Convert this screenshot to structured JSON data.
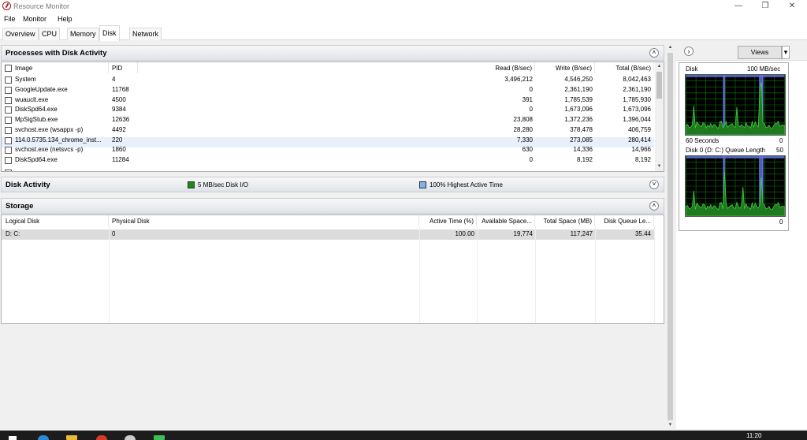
{
  "window": {
    "title": "Resource Monitor",
    "minimize_glyph": "—",
    "maximize_glyph": "❐",
    "close_glyph": "✕"
  },
  "menu": [
    "File",
    "Monitor",
    "Help"
  ],
  "tabs": [
    "Overview",
    "CPU",
    "Memory",
    "Disk",
    "Network"
  ],
  "active_tab": "Disk",
  "processes": {
    "title": "Processes with Disk Activity",
    "collapse_glyph": "˄",
    "columns": [
      "Image",
      "PID",
      "Read (B/sec)",
      "Write (B/sec)",
      "Total (B/sec)"
    ],
    "rows": [
      {
        "image": "System",
        "pid": "4",
        "read": "3,496,212",
        "write": "4,546,250",
        "total": "8,042,463"
      },
      {
        "image": "GoogleUpdate.exe",
        "pid": "11768",
        "read": "0",
        "write": "2,361,190",
        "total": "2,361,190"
      },
      {
        "image": "wuauclt.exe",
        "pid": "4500",
        "read": "391",
        "write": "1,785,539",
        "total": "1,785,930"
      },
      {
        "image": "DiskSpd64.exe",
        "pid": "9384",
        "read": "0",
        "write": "1,673,096",
        "total": "1,673,096"
      },
      {
        "image": "MpSigStub.exe",
        "pid": "12636",
        "read": "23,808",
        "write": "1,372,236",
        "total": "1,396,044"
      },
      {
        "image": "svchost.exe (wsappx -p)",
        "pid": "4492",
        "read": "28,280",
        "write": "378,478",
        "total": "406,759"
      },
      {
        "image": "114.0.5735.134_chrome_inst...",
        "pid": "220",
        "read": "7,330",
        "write": "273,085",
        "total": "280,414"
      },
      {
        "image": "svchost.exe (netsvcs -p)",
        "pid": "1860",
        "read": "630",
        "write": "14,336",
        "total": "14,966"
      },
      {
        "image": "DiskSpd64.exe",
        "pid": "11284",
        "read": "0",
        "write": "8,192",
        "total": "8,192"
      }
    ]
  },
  "disk_activity": {
    "title": "Disk Activity",
    "legend_io": "5 MB/sec Disk I/O",
    "legend_active": "100% Highest Active Time",
    "expand_glyph": "˅",
    "io_color": "#1a8a1a",
    "active_color": "#7fb2e8"
  },
  "storage": {
    "title": "Storage",
    "collapse_glyph": "˄",
    "columns": [
      "Logical Disk",
      "Physical Disk",
      "Active Time (%)",
      "Available Space...",
      "Total Space (MB)",
      "Disk Queue Le..."
    ],
    "rows": [
      {
        "logical": "D: C:",
        "physical": "0",
        "active": "100.00",
        "available": "19,774",
        "total": "117,247",
        "queue": "35.44"
      }
    ]
  },
  "right_panel": {
    "expand_glyph": "›",
    "views_label": "Views",
    "views_arrow": "▾",
    "graph1_title": "Disk",
    "graph1_scale": "100 MB/sec",
    "graph1_footer_left": "60 Seconds",
    "graph1_footer_right": "0",
    "graph2_title": "Disk 0 (D: C:) Queue Length",
    "graph2_scale": "50",
    "graph2_footer_right": "0",
    "grid_color": "#0a7a0a",
    "line_color": "#40d040",
    "bar_color": "#6070e0"
  },
  "taskbar": {
    "time": "11:20"
  }
}
